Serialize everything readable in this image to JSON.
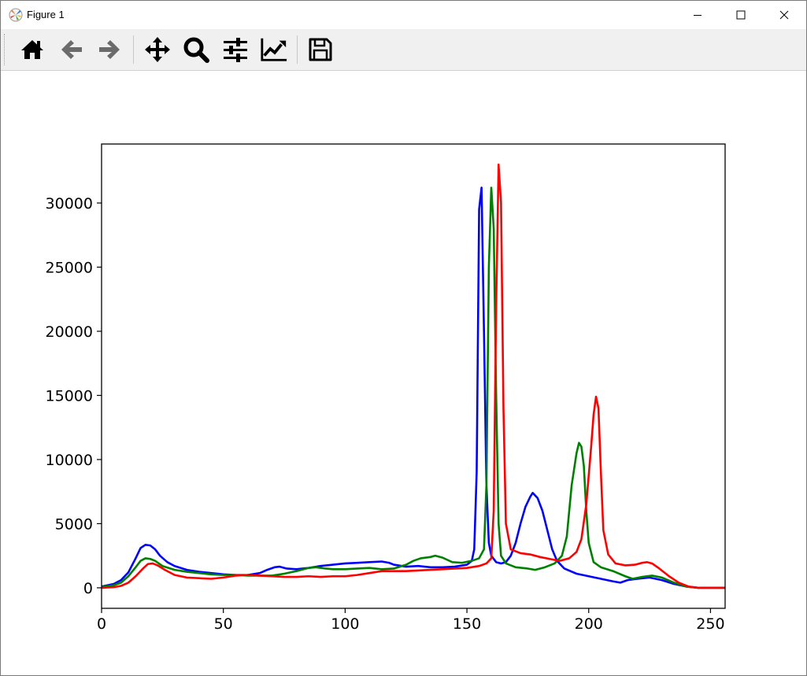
{
  "window": {
    "title": "Figure 1",
    "icon": "matplotlib-icon",
    "controls": [
      "minimize-icon",
      "maximize-icon",
      "close-icon"
    ]
  },
  "toolbar": {
    "buttons": [
      "home-icon",
      "back-icon",
      "forward-icon",
      "pan-icon",
      "zoom-icon",
      "configure-subplots-icon",
      "edit-axis-icon",
      "save-icon"
    ]
  },
  "chart_data": {
    "type": "line",
    "title": "",
    "xlabel": "",
    "ylabel": "",
    "xlim": [
      0,
      256
    ],
    "ylim": [
      -1600,
      34600
    ],
    "xticks": [
      0,
      50,
      100,
      150,
      200,
      250
    ],
    "yticks": [
      0,
      5000,
      10000,
      15000,
      20000,
      25000,
      30000
    ],
    "xtick_labels": [
      "0",
      "50",
      "100",
      "150",
      "200",
      "250"
    ],
    "ytick_labels": [
      "0",
      "5000",
      "10000",
      "15000",
      "20000",
      "25000",
      "30000"
    ],
    "grid": false,
    "legend": "none",
    "series": [
      {
        "color": "#0000ff",
        "points": [
          [
            0,
            100
          ],
          [
            5,
            300
          ],
          [
            8,
            600
          ],
          [
            11,
            1200
          ],
          [
            14,
            2300
          ],
          [
            16,
            3100
          ],
          [
            18,
            3350
          ],
          [
            20,
            3300
          ],
          [
            22,
            3000
          ],
          [
            24,
            2500
          ],
          [
            27,
            2000
          ],
          [
            30,
            1700
          ],
          [
            35,
            1400
          ],
          [
            40,
            1250
          ],
          [
            45,
            1150
          ],
          [
            50,
            1050
          ],
          [
            55,
            1000
          ],
          [
            60,
            1000
          ],
          [
            65,
            1150
          ],
          [
            68,
            1400
          ],
          [
            71,
            1600
          ],
          [
            73,
            1650
          ],
          [
            76,
            1500
          ],
          [
            80,
            1450
          ],
          [
            85,
            1550
          ],
          [
            90,
            1700
          ],
          [
            95,
            1800
          ],
          [
            100,
            1900
          ],
          [
            105,
            1950
          ],
          [
            110,
            2000
          ],
          [
            115,
            2050
          ],
          [
            118,
            1950
          ],
          [
            120,
            1800
          ],
          [
            125,
            1650
          ],
          [
            130,
            1700
          ],
          [
            135,
            1600
          ],
          [
            140,
            1600
          ],
          [
            145,
            1650
          ],
          [
            150,
            1800
          ],
          [
            152,
            2100
          ],
          [
            153,
            3000
          ],
          [
            154,
            9000
          ],
          [
            155,
            29500
          ],
          [
            156,
            31200
          ],
          [
            157,
            20000
          ],
          [
            158,
            8000
          ],
          [
            159,
            3500
          ],
          [
            160,
            2500
          ],
          [
            162,
            2000
          ],
          [
            164,
            1900
          ],
          [
            166,
            2000
          ],
          [
            168,
            2500
          ],
          [
            170,
            3500
          ],
          [
            172,
            5000
          ],
          [
            174,
            6300
          ],
          [
            176,
            7100
          ],
          [
            177,
            7400
          ],
          [
            179,
            7000
          ],
          [
            181,
            6000
          ],
          [
            183,
            4500
          ],
          [
            185,
            3000
          ],
          [
            187,
            2100
          ],
          [
            190,
            1500
          ],
          [
            195,
            1100
          ],
          [
            200,
            900
          ],
          [
            205,
            700
          ],
          [
            210,
            500
          ],
          [
            213,
            400
          ],
          [
            216,
            600
          ],
          [
            220,
            700
          ],
          [
            225,
            800
          ],
          [
            230,
            600
          ],
          [
            235,
            300
          ],
          [
            240,
            100
          ],
          [
            245,
            0
          ],
          [
            256,
            0
          ]
        ]
      },
      {
        "color": "#008000",
        "points": [
          [
            0,
            50
          ],
          [
            5,
            200
          ],
          [
            8,
            400
          ],
          [
            11,
            900
          ],
          [
            14,
            1600
          ],
          [
            16,
            2100
          ],
          [
            18,
            2300
          ],
          [
            20,
            2250
          ],
          [
            22,
            2100
          ],
          [
            25,
            1700
          ],
          [
            30,
            1400
          ],
          [
            35,
            1250
          ],
          [
            40,
            1150
          ],
          [
            45,
            1050
          ],
          [
            50,
            1000
          ],
          [
            55,
            1000
          ],
          [
            60,
            950
          ],
          [
            65,
            950
          ],
          [
            70,
            950
          ],
          [
            75,
            1100
          ],
          [
            80,
            1300
          ],
          [
            85,
            1550
          ],
          [
            88,
            1600
          ],
          [
            92,
            1500
          ],
          [
            95,
            1450
          ],
          [
            100,
            1450
          ],
          [
            105,
            1500
          ],
          [
            110,
            1550
          ],
          [
            115,
            1450
          ],
          [
            120,
            1500
          ],
          [
            125,
            1800
          ],
          [
            128,
            2100
          ],
          [
            131,
            2300
          ],
          [
            135,
            2400
          ],
          [
            137,
            2500
          ],
          [
            140,
            2350
          ],
          [
            144,
            2000
          ],
          [
            148,
            1950
          ],
          [
            152,
            2100
          ],
          [
            155,
            2300
          ],
          [
            157,
            3000
          ],
          [
            158,
            8000
          ],
          [
            159,
            25000
          ],
          [
            160,
            31200
          ],
          [
            161,
            28000
          ],
          [
            162,
            15000
          ],
          [
            163,
            5000
          ],
          [
            164,
            2500
          ],
          [
            166,
            1900
          ],
          [
            170,
            1600
          ],
          [
            175,
            1500
          ],
          [
            178,
            1400
          ],
          [
            182,
            1600
          ],
          [
            186,
            1900
          ],
          [
            189,
            2500
          ],
          [
            191,
            4000
          ],
          [
            193,
            8000
          ],
          [
            195,
            10500
          ],
          [
            196,
            11300
          ],
          [
            197,
            11000
          ],
          [
            198,
            9500
          ],
          [
            199,
            6000
          ],
          [
            200,
            3500
          ],
          [
            202,
            2000
          ],
          [
            205,
            1600
          ],
          [
            210,
            1300
          ],
          [
            215,
            900
          ],
          [
            218,
            700
          ],
          [
            222,
            850
          ],
          [
            226,
            950
          ],
          [
            230,
            800
          ],
          [
            235,
            400
          ],
          [
            240,
            100
          ],
          [
            245,
            0
          ],
          [
            256,
            0
          ]
        ]
      },
      {
        "color": "#ff0000",
        "points": [
          [
            0,
            0
          ],
          [
            5,
            50
          ],
          [
            8,
            150
          ],
          [
            11,
            400
          ],
          [
            14,
            900
          ],
          [
            17,
            1500
          ],
          [
            19,
            1850
          ],
          [
            21,
            1900
          ],
          [
            23,
            1750
          ],
          [
            26,
            1400
          ],
          [
            30,
            1000
          ],
          [
            35,
            800
          ],
          [
            40,
            750
          ],
          [
            45,
            700
          ],
          [
            50,
            800
          ],
          [
            55,
            950
          ],
          [
            60,
            1000
          ],
          [
            65,
            950
          ],
          [
            70,
            900
          ],
          [
            75,
            850
          ],
          [
            80,
            850
          ],
          [
            85,
            900
          ],
          [
            90,
            850
          ],
          [
            95,
            900
          ],
          [
            100,
            900
          ],
          [
            105,
            1000
          ],
          [
            110,
            1150
          ],
          [
            115,
            1300
          ],
          [
            120,
            1300
          ],
          [
            125,
            1300
          ],
          [
            130,
            1350
          ],
          [
            135,
            1400
          ],
          [
            140,
            1450
          ],
          [
            145,
            1500
          ],
          [
            150,
            1550
          ],
          [
            155,
            1700
          ],
          [
            158,
            1900
          ],
          [
            160,
            2300
          ],
          [
            161,
            6000
          ],
          [
            162,
            22000
          ],
          [
            163,
            33000
          ],
          [
            164,
            30000
          ],
          [
            165,
            14000
          ],
          [
            166,
            5000
          ],
          [
            168,
            3000
          ],
          [
            172,
            2700
          ],
          [
            176,
            2600
          ],
          [
            180,
            2400
          ],
          [
            184,
            2250
          ],
          [
            188,
            2100
          ],
          [
            192,
            2300
          ],
          [
            195,
            2800
          ],
          [
            197,
            3800
          ],
          [
            199,
            6500
          ],
          [
            201,
            11000
          ],
          [
            202,
            13500
          ],
          [
            203,
            14900
          ],
          [
            204,
            14000
          ],
          [
            205,
            9000
          ],
          [
            206,
            4500
          ],
          [
            208,
            2600
          ],
          [
            211,
            1900
          ],
          [
            215,
            1750
          ],
          [
            219,
            1800
          ],
          [
            222,
            1950
          ],
          [
            224,
            2000
          ],
          [
            226,
            1900
          ],
          [
            229,
            1500
          ],
          [
            233,
            900
          ],
          [
            237,
            400
          ],
          [
            241,
            100
          ],
          [
            245,
            0
          ],
          [
            256,
            0
          ]
        ]
      }
    ]
  }
}
